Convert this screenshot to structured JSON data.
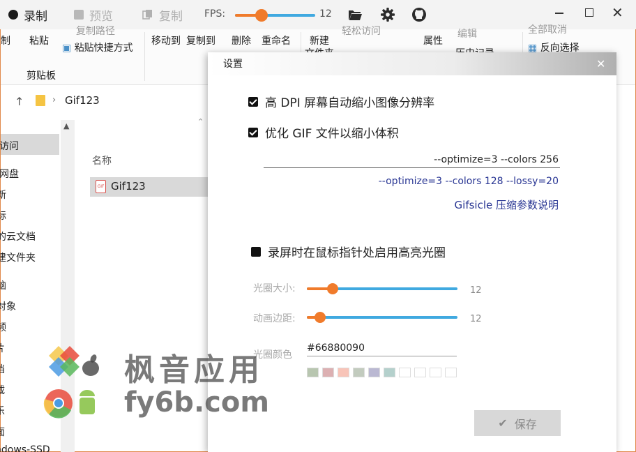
{
  "toolbar": {
    "record_label": "录制",
    "preview_label": "预览",
    "copy_label": "复制",
    "fps_label": "FPS:",
    "fps_value": "12",
    "fps_fraction": 0.33,
    "icons": [
      "folder-open-icon",
      "gear-icon",
      "github-icon"
    ]
  },
  "explorer": {
    "ribbon": {
      "copy_cut": "复制",
      "paste": "粘贴",
      "copy_path": "复制路径",
      "paste_shortcut": "粘贴快捷方式",
      "clipboard_group": "剪贴板",
      "move_to": "移动到",
      "copy_to": "复制到",
      "delete": "删除",
      "rename": "重命名",
      "new": "新建",
      "new_folder_suffix": "文件夹",
      "easy_access": "轻松访问",
      "properties": "属性",
      "edit": "编辑",
      "history": "历史记录",
      "select_none": "全部取消",
      "invert_selection": "反向选择"
    },
    "address": {
      "path": "Gif123"
    },
    "nav": {
      "items": [
        "访问",
        "网盘",
        "新",
        "标",
        "的云文档",
        "建文件夹",
        "脑",
        "对象",
        "频",
        "片",
        "档",
        "载",
        "乐",
        "面",
        "ndows-SSD"
      ]
    },
    "list": {
      "header_name": "名称",
      "file_name": "Gif123"
    }
  },
  "dialog": {
    "title": "设置",
    "hidpi_label": "高 DPI 屏幕自动缩小图像分辨率",
    "hidpi_checked": true,
    "optimize_label": "优化 GIF 文件以缩小体积",
    "optimize_checked": true,
    "optimize_params": "--optimize=3 --colors 256",
    "optimize_hint": "--optimize=3 --colors 128 --lossy=20",
    "optimize_link": "Gifsicle 压缩参数说明",
    "highlight_label": "录屏时在鼠标指针处启用高亮光圈",
    "highlight_checked": false,
    "halo_size_label": "光圈大小:",
    "halo_size_value": "12",
    "halo_size_fraction": 0.17,
    "anim_margin_label": "动画边距:",
    "anim_margin_value": "12",
    "anim_margin_fraction": 0.09,
    "halo_color_label": "光圈颜色",
    "halo_color_value": "#66880090",
    "swatches": [
      "#b8c6b0",
      "#dcb0b2",
      "#f8c4b8",
      "#c2cbbe",
      "#bab8d2",
      "#b4d0cc",
      "#ffffff",
      "#ffffff",
      "#ffffff",
      "#ffffff"
    ],
    "save_label": "保存"
  },
  "watermark": {
    "brand": "枫音应用",
    "site": "fy6b.com"
  },
  "colors": {
    "accent_orange": "#f07b2b",
    "slider_blue": "#40a9e0",
    "link_navy": "#283593"
  }
}
